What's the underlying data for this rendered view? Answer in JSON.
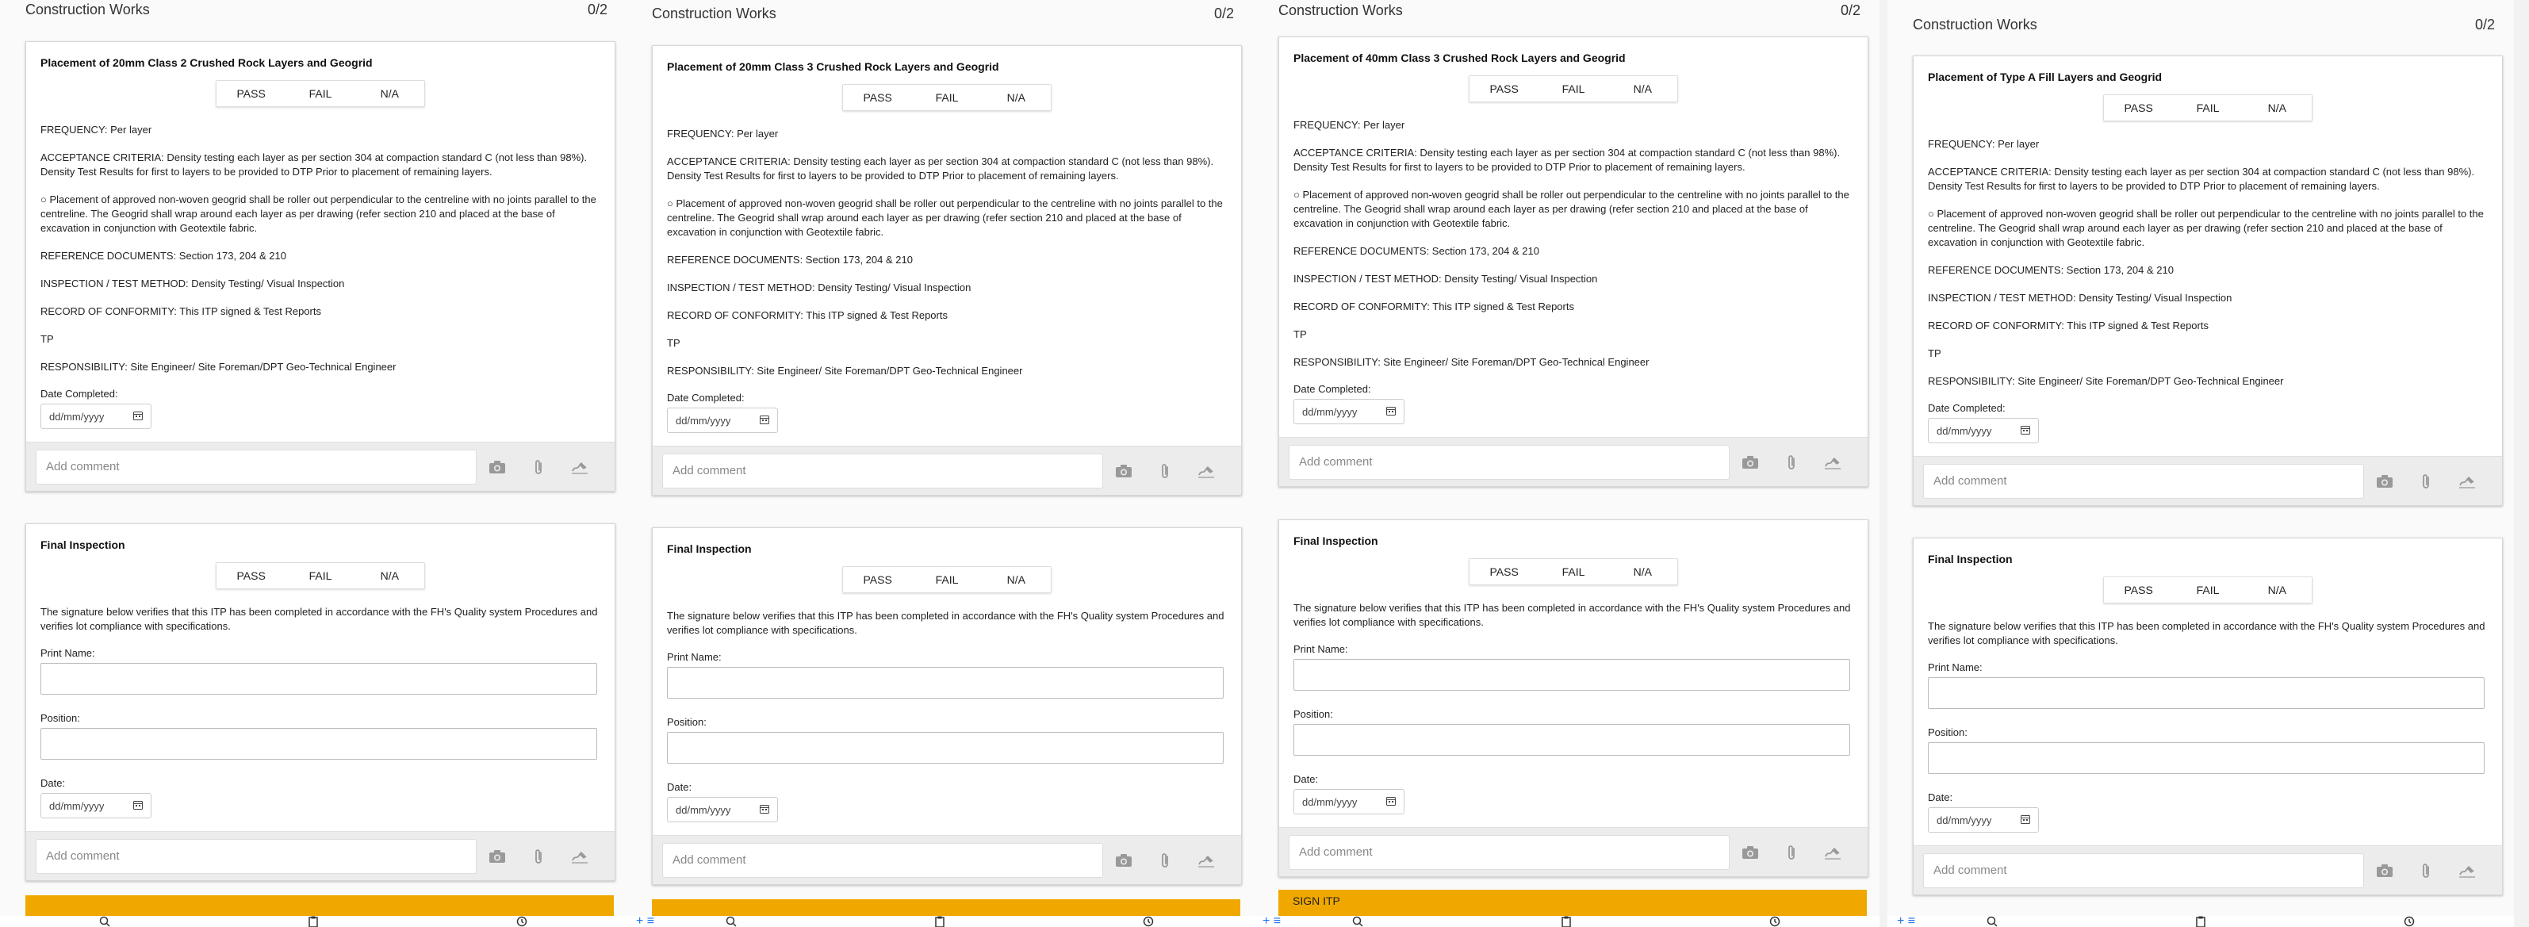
{
  "panels": [
    {
      "header": {
        "title": "Construction Works",
        "count": "0/2"
      },
      "item": {
        "title": "Placement of 20mm Class 2 Crushed Rock Layers and Geogrid",
        "pass": "PASS",
        "fail": "FAIL",
        "na": "N/A",
        "frequency": "FREQUENCY: Per layer",
        "acceptance": "ACCEPTANCE CRITERIA: Density testing each layer as per section 304 at compaction standard C (not less than 98%). Density Test Results for first to layers to be provided to DTP Prior to placement of remaining layers.",
        "placement": "○ Placement of approved non-woven geogrid shall be roller out perpendicular to the centreline with no joints parallel to the centreline. The Geogrid shall wrap around each layer as per drawing (refer section 210 and placed at the base of excavation in conjunction with Geotextile fabric.",
        "reference": "REFERENCE DOCUMENTS: Section 173, 204 & 210",
        "inspection": "INSPECTION / TEST METHOD: Density Testing/ Visual Inspection",
        "record": "RECORD OF CONFORMITY: This ITP signed & Test Reports",
        "tp": "TP",
        "responsibility": "RESPONSIBILITY: Site Engineer/ Site Foreman/DPT Geo-Technical Engineer",
        "date_label": "Date Completed:",
        "date_placeholder": "dd/mm/yyyy",
        "comment_placeholder": "Add comment"
      },
      "final": {
        "title": "Final Inspection",
        "pass": "PASS",
        "fail": "FAIL",
        "na": "N/A",
        "statement": "The signature below verifies that this ITP has been completed in accordance with the FH's Quality system Procedures and verifies lot compliance with specifications.",
        "print_name_label": "Print Name:",
        "position_label": "Position:",
        "date_label": "Date:",
        "date_placeholder": "dd/mm/yyyy",
        "comment_placeholder": "Add comment"
      },
      "sign_label": ""
    },
    {
      "header": {
        "title": "Construction Works",
        "count": "0/2"
      },
      "item": {
        "title": "Placement of 20mm Class 3 Crushed Rock Layers and Geogrid",
        "pass": "PASS",
        "fail": "FAIL",
        "na": "N/A",
        "frequency": "FREQUENCY: Per layer",
        "acceptance": "ACCEPTANCE CRITERIA: Density testing each layer as per section 304 at compaction standard C (not less than 98%). Density Test Results for first to layers to be provided to DTP Prior to placement of remaining layers.",
        "placement": "○ Placement of approved non-woven geogrid shall be roller out perpendicular to the centreline with no joints parallel to the centreline. The Geogrid shall wrap around each layer as per drawing (refer section 210 and placed at the base of excavation in conjunction with Geotextile fabric.",
        "reference": "REFERENCE DOCUMENTS: Section 173, 204 & 210",
        "inspection": "INSPECTION / TEST METHOD: Density Testing/ Visual Inspection",
        "record": "RECORD OF CONFORMITY: This ITP signed & Test Reports",
        "tp": "TP",
        "responsibility": "RESPONSIBILITY: Site Engineer/ Site Foreman/DPT Geo-Technical Engineer",
        "date_label": "Date Completed:",
        "date_placeholder": "dd/mm/yyyy",
        "comment_placeholder": "Add comment"
      },
      "final": {
        "title": "Final Inspection",
        "pass": "PASS",
        "fail": "FAIL",
        "na": "N/A",
        "statement": "The signature below verifies that this ITP has been completed in accordance with the FH's Quality system Procedures and verifies lot compliance with specifications.",
        "print_name_label": "Print Name:",
        "position_label": "Position:",
        "date_label": "Date:",
        "date_placeholder": "dd/mm/yyyy",
        "comment_placeholder": "Add comment"
      },
      "sign_label": ""
    },
    {
      "header": {
        "title": "Construction Works",
        "count": "0/2"
      },
      "item": {
        "title": "Placement of 40mm Class 3 Crushed Rock Layers and Geogrid",
        "pass": "PASS",
        "fail": "FAIL",
        "na": "N/A",
        "frequency": "FREQUENCY: Per layer",
        "acceptance": "ACCEPTANCE CRITERIA: Density testing each layer as per section 304 at compaction standard C (not less than 98%). Density Test Results for first to layers to be provided to DTP Prior to placement of remaining layers.",
        "placement": "○ Placement of approved non-woven geogrid shall be roller out perpendicular to the centreline with no joints parallel to the centreline. The Geogrid shall wrap around each layer as per drawing (refer section 210 and placed at the base of excavation in conjunction with Geotextile fabric.",
        "reference": "REFERENCE DOCUMENTS: Section 173, 204 & 210",
        "inspection": "INSPECTION / TEST METHOD: Density Testing/ Visual Inspection",
        "record": "RECORD OF CONFORMITY: This ITP signed & Test Reports",
        "tp": "TP",
        "responsibility": "RESPONSIBILITY: Site Engineer/ Site Foreman/DPT Geo-Technical Engineer",
        "date_label": "Date Completed:",
        "date_placeholder": "dd/mm/yyyy",
        "comment_placeholder": "Add comment"
      },
      "final": {
        "title": "Final Inspection",
        "pass": "PASS",
        "fail": "FAIL",
        "na": "N/A",
        "statement": "The signature below verifies that this ITP has been completed in accordance with the FH's Quality system Procedures and verifies lot compliance with specifications.",
        "print_name_label": "Print Name:",
        "position_label": "Position:",
        "date_label": "Date:",
        "date_placeholder": "dd/mm/yyyy",
        "comment_placeholder": "Add comment"
      },
      "sign_label": "SIGN ITP"
    },
    {
      "header": {
        "title": "Construction Works",
        "count": "0/2"
      },
      "item": {
        "title": "Placement of Type A Fill Layers and Geogrid",
        "pass": "PASS",
        "fail": "FAIL",
        "na": "N/A",
        "frequency": "FREQUENCY: Per layer",
        "acceptance": "ACCEPTANCE CRITERIA: Density testing each layer as per section 304 at compaction standard C (not less than 98%). Density Test Results for first to layers to be provided to DTP Prior to placement of remaining layers.",
        "placement": "○ Placement of approved non-woven geogrid shall be roller out perpendicular to the centreline with no joints parallel to the centreline. The Geogrid shall wrap around each layer as per drawing (refer section 210 and placed at the base of excavation in conjunction with Geotextile fabric.",
        "reference": "REFERENCE DOCUMENTS: Section 173, 204 & 210",
        "inspection": "INSPECTION / TEST METHOD: Density Testing/ Visual Inspection",
        "record": "RECORD OF CONFORMITY: This ITP signed & Test Reports",
        "tp": "TP",
        "responsibility": "RESPONSIBILITY: Site Engineer/ Site Foreman/DPT Geo-Technical Engineer",
        "date_label": "Date Completed:",
        "date_placeholder": "dd/mm/yyyy",
        "comment_placeholder": "Add comment"
      },
      "final": {
        "title": "Final Inspection",
        "pass": "PASS",
        "fail": "FAIL",
        "na": "N/A",
        "statement": "The signature below verifies that this ITP has been completed in accordance with the FH's Quality system Procedures and verifies lot compliance with specifications.",
        "print_name_label": "Print Name:",
        "position_label": "Position:",
        "date_label": "Date:",
        "date_placeholder": "dd/mm/yyyy",
        "comment_placeholder": "Add comment"
      },
      "sign_label": ""
    }
  ],
  "colors": {
    "accent": "#f0a800",
    "nav_blue": "#1a73e8"
  },
  "icons": [
    "camera-icon",
    "paperclip-icon",
    "signature-icon",
    "calendar-icon",
    "search-icon",
    "clipboard-icon",
    "history-icon",
    "menu-icon",
    "plus-icon"
  ]
}
